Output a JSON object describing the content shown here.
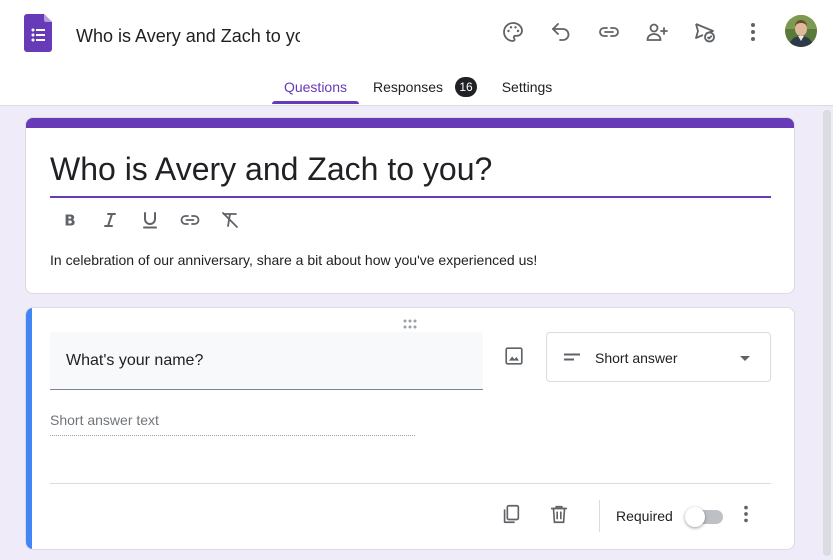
{
  "app": {
    "doc_title": "Who is Avery and Zach to you?",
    "brand_color": "#673ab7",
    "icons": {
      "logo": "forms-logo-icon",
      "palette": "palette-icon",
      "undo": "undo-icon",
      "link": "link-icon",
      "add_collaborator": "add-person-icon",
      "publish": "send-check-icon",
      "more": "more-vert-icon",
      "avatar": "avatar"
    }
  },
  "tabs": [
    {
      "label": "Questions",
      "active": true
    },
    {
      "label": "Responses",
      "badge": "16"
    },
    {
      "label": "Settings"
    }
  ],
  "form": {
    "title": "Who is Avery and Zach to you?",
    "description": "In celebration of our anniversary, share a bit about how you've experienced us!",
    "formatting": [
      "bold-icon",
      "italic-icon",
      "underline-icon",
      "link-icon",
      "clear-format-icon"
    ]
  },
  "question": {
    "text": "What's your name?",
    "type_label": "Short answer",
    "answer_placeholder": "Short answer text",
    "required_label": "Required",
    "required": false,
    "accent_color": "#4285f4"
  }
}
